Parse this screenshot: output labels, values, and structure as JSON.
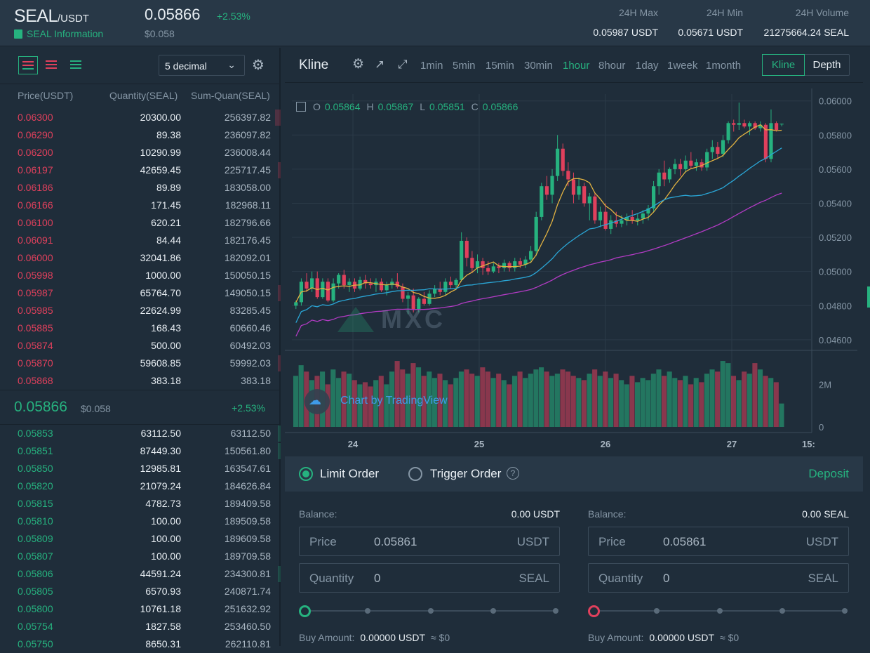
{
  "header": {
    "pair_base": "SEAL",
    "pair_quote": "/USDT",
    "info_link": "SEAL Information",
    "last_price": "0.05866",
    "change": "+2.53%",
    "usd_price": "$0.058",
    "stats": [
      {
        "label": "24H Max",
        "value": "0.05987 USDT"
      },
      {
        "label": "24H Min",
        "value": "0.05671 USDT"
      },
      {
        "label": "24H Volume",
        "value": "21275664.24 SEAL"
      }
    ]
  },
  "orderbook": {
    "decimal": "5 decimal",
    "headers": {
      "price": "Price(USDT)",
      "quantity": "Quantity(SEAL)",
      "sum": "Sum-Quan(SEAL)"
    },
    "asks": [
      {
        "price": "0.06300",
        "qty": "20300.00",
        "sum": "256397.82",
        "depth": 0.02
      },
      {
        "price": "0.06290",
        "qty": "89.38",
        "sum": "236097.82",
        "depth": 0.0
      },
      {
        "price": "0.06200",
        "qty": "10290.99",
        "sum": "236008.44",
        "depth": 0.0
      },
      {
        "price": "0.06197",
        "qty": "42659.45",
        "sum": "225717.45",
        "depth": 0.01
      },
      {
        "price": "0.06186",
        "qty": "89.89",
        "sum": "183058.00",
        "depth": 0.0
      },
      {
        "price": "0.06166",
        "qty": "171.45",
        "sum": "182968.11",
        "depth": 0.0
      },
      {
        "price": "0.06100",
        "qty": "620.21",
        "sum": "182796.66",
        "depth": 0.0
      },
      {
        "price": "0.06091",
        "qty": "84.44",
        "sum": "182176.45",
        "depth": 0.0
      },
      {
        "price": "0.06000",
        "qty": "32041.86",
        "sum": "182092.01",
        "depth": 0.0
      },
      {
        "price": "0.05998",
        "qty": "1000.00",
        "sum": "150050.15",
        "depth": 0.0
      },
      {
        "price": "0.05987",
        "qty": "65764.70",
        "sum": "149050.15",
        "depth": 0.01
      },
      {
        "price": "0.05985",
        "qty": "22624.99",
        "sum": "83285.45",
        "depth": 0.0
      },
      {
        "price": "0.05885",
        "qty": "168.43",
        "sum": "60660.46",
        "depth": 0.0
      },
      {
        "price": "0.05874",
        "qty": "500.00",
        "sum": "60492.03",
        "depth": 0.0
      },
      {
        "price": "0.05870",
        "qty": "59608.85",
        "sum": "59992.03",
        "depth": 0.01
      },
      {
        "price": "0.05868",
        "qty": "383.18",
        "sum": "383.18",
        "depth": 0.0
      }
    ],
    "mid_price": "0.05866",
    "mid_usd": "$0.058",
    "mid_change": "+2.53%",
    "bids": [
      {
        "price": "0.05853",
        "qty": "63112.50",
        "sum": "63112.50",
        "depth": 0.01
      },
      {
        "price": "0.05851",
        "qty": "87449.30",
        "sum": "150561.80",
        "depth": 0.01
      },
      {
        "price": "0.05850",
        "qty": "12985.81",
        "sum": "163547.61",
        "depth": 0.0
      },
      {
        "price": "0.05820",
        "qty": "21079.24",
        "sum": "184626.84",
        "depth": 0.0
      },
      {
        "price": "0.05815",
        "qty": "4782.73",
        "sum": "189409.58",
        "depth": 0.0
      },
      {
        "price": "0.05810",
        "qty": "100.00",
        "sum": "189509.58",
        "depth": 0.0
      },
      {
        "price": "0.05809",
        "qty": "100.00",
        "sum": "189609.58",
        "depth": 0.0
      },
      {
        "price": "0.05807",
        "qty": "100.00",
        "sum": "189709.58",
        "depth": 0.0
      },
      {
        "price": "0.05806",
        "qty": "44591.24",
        "sum": "234300.81",
        "depth": 0.01
      },
      {
        "price": "0.05805",
        "qty": "6570.93",
        "sum": "240871.74",
        "depth": 0.0
      },
      {
        "price": "0.05800",
        "qty": "10761.18",
        "sum": "251632.92",
        "depth": 0.0
      },
      {
        "price": "0.05754",
        "qty": "1827.58",
        "sum": "253460.50",
        "depth": 0.0
      },
      {
        "price": "0.05750",
        "qty": "8650.31",
        "sum": "262110.81",
        "depth": 0.0
      }
    ]
  },
  "chart": {
    "title": "Kline",
    "intervals": [
      "1min",
      "5min",
      "15min",
      "30min",
      "1hour",
      "8hour",
      "1day",
      "1week",
      "1month"
    ],
    "active_interval": "1hour",
    "views": [
      "Kline",
      "Depth"
    ],
    "active_view": "Kline",
    "ohlc": {
      "o": "0.05864",
      "h": "0.05867",
      "l": "0.05851",
      "c": "0.05866"
    },
    "watermark": "MXC",
    "tradingview": "Chart by TradingView",
    "x_ticks": [
      "24",
      "25",
      "26",
      "27",
      "15:"
    ],
    "volume_ticks": [
      "2M",
      "0"
    ]
  },
  "chart_data": {
    "type": "candlestick",
    "y_ticks": [
      "0.06000",
      "0.05800",
      "0.05600",
      "0.05400",
      "0.05200",
      "0.05000",
      "0.04800",
      "0.04600"
    ],
    "ylim": [
      0.0455,
      0.0604
    ],
    "volume_ylim": [
      0,
      3300000
    ],
    "colors": {
      "up": "#26b27f",
      "down": "#e0405c",
      "ma7": "#e3b341",
      "ma25": "#2aa6d6",
      "ma99": "#b23bc4"
    },
    "candles": [
      [
        0.048,
        0.0483,
        0.0478,
        0.0482,
        2400000
      ],
      [
        0.0482,
        0.0496,
        0.048,
        0.0494,
        2900000
      ],
      [
        0.0494,
        0.0499,
        0.0488,
        0.049,
        2600000
      ],
      [
        0.049,
        0.05,
        0.0488,
        0.0496,
        2200000
      ],
      [
        0.0496,
        0.05,
        0.0484,
        0.0485,
        2400000
      ],
      [
        0.0485,
        0.0496,
        0.0484,
        0.0494,
        2600000
      ],
      [
        0.0494,
        0.0496,
        0.0482,
        0.0483,
        2000000
      ],
      [
        0.0483,
        0.0496,
        0.0482,
        0.0493,
        2700000
      ],
      [
        0.0493,
        0.0499,
        0.049,
        0.0498,
        2300000
      ],
      [
        0.0498,
        0.0501,
        0.049,
        0.0492,
        2600000
      ],
      [
        0.0492,
        0.0496,
        0.0488,
        0.0494,
        2500000
      ],
      [
        0.0494,
        0.0496,
        0.0488,
        0.049,
        2200000
      ],
      [
        0.049,
        0.0497,
        0.0489,
        0.0495,
        2000000
      ],
      [
        0.0495,
        0.0498,
        0.049,
        0.0493,
        2100000
      ],
      [
        0.0493,
        0.0496,
        0.049,
        0.0492,
        1900000
      ],
      [
        0.0492,
        0.0496,
        0.0488,
        0.0494,
        2200000
      ],
      [
        0.0494,
        0.0496,
        0.0488,
        0.0489,
        2400000
      ],
      [
        0.0489,
        0.0494,
        0.0486,
        0.0492,
        2000000
      ],
      [
        0.0492,
        0.0496,
        0.049,
        0.0494,
        2600000
      ],
      [
        0.0494,
        0.0499,
        0.049,
        0.0491,
        3100000
      ],
      [
        0.0491,
        0.0493,
        0.0482,
        0.0484,
        2700000
      ],
      [
        0.0484,
        0.0488,
        0.0475,
        0.0486,
        2500000
      ],
      [
        0.0486,
        0.049,
        0.0476,
        0.0478,
        3000000
      ],
      [
        0.0478,
        0.0485,
        0.0476,
        0.0484,
        2800000
      ],
      [
        0.0484,
        0.0488,
        0.048,
        0.0481,
        2400000
      ],
      [
        0.0481,
        0.0489,
        0.048,
        0.0487,
        2600000
      ],
      [
        0.0487,
        0.0492,
        0.0485,
        0.049,
        2300000
      ],
      [
        0.049,
        0.0494,
        0.0486,
        0.0488,
        2500000
      ],
      [
        0.0488,
        0.0496,
        0.0486,
        0.0494,
        2200000
      ],
      [
        0.0494,
        0.0497,
        0.049,
        0.0492,
        2000000
      ],
      [
        0.0492,
        0.0496,
        0.049,
        0.0495,
        2300000
      ],
      [
        0.0495,
        0.0523,
        0.0494,
        0.0518,
        2600000
      ],
      [
        0.0518,
        0.052,
        0.0503,
        0.0508,
        2700000
      ],
      [
        0.0508,
        0.0512,
        0.0499,
        0.0502,
        2500000
      ],
      [
        0.0502,
        0.051,
        0.0499,
        0.0506,
        2400000
      ],
      [
        0.0506,
        0.0508,
        0.0498,
        0.0502,
        2800000
      ],
      [
        0.0502,
        0.0506,
        0.0498,
        0.05,
        2600000
      ],
      [
        0.05,
        0.0505,
        0.0499,
        0.0503,
        2300000
      ],
      [
        0.0503,
        0.0505,
        0.0499,
        0.0502,
        2500000
      ],
      [
        0.0502,
        0.0507,
        0.05,
        0.0505,
        2200000
      ],
      [
        0.0505,
        0.0506,
        0.05,
        0.0502,
        2000000
      ],
      [
        0.0502,
        0.0508,
        0.05,
        0.0506,
        2400000
      ],
      [
        0.0506,
        0.0508,
        0.0502,
        0.0504,
        2600000
      ],
      [
        0.0504,
        0.0509,
        0.0502,
        0.0507,
        2300000
      ],
      [
        0.0507,
        0.0515,
        0.0505,
        0.0512,
        2500000
      ],
      [
        0.0512,
        0.0535,
        0.0509,
        0.0532,
        2700000
      ],
      [
        0.0532,
        0.0552,
        0.053,
        0.055,
        2800000
      ],
      [
        0.055,
        0.0556,
        0.0542,
        0.0545,
        2600000
      ],
      [
        0.0545,
        0.056,
        0.054,
        0.0556,
        2400000
      ],
      [
        0.0556,
        0.058,
        0.0553,
        0.0572,
        2500000
      ],
      [
        0.0572,
        0.0575,
        0.0556,
        0.0559,
        2700000
      ],
      [
        0.0559,
        0.0564,
        0.055,
        0.0554,
        2600000
      ],
      [
        0.0554,
        0.0558,
        0.054,
        0.0545,
        2400000
      ],
      [
        0.0545,
        0.0555,
        0.0542,
        0.055,
        2300000
      ],
      [
        0.055,
        0.0552,
        0.0538,
        0.054,
        2200000
      ],
      [
        0.054,
        0.0546,
        0.053,
        0.0544,
        2500000
      ],
      [
        0.0544,
        0.0546,
        0.0528,
        0.053,
        2700000
      ],
      [
        0.053,
        0.0538,
        0.0526,
        0.0535,
        2400000
      ],
      [
        0.0535,
        0.054,
        0.0524,
        0.0525,
        2600000
      ],
      [
        0.0525,
        0.0533,
        0.0522,
        0.053,
        2300000
      ],
      [
        0.053,
        0.0535,
        0.0526,
        0.0528,
        2500000
      ],
      [
        0.0528,
        0.0533,
        0.0526,
        0.053,
        2200000
      ],
      [
        0.053,
        0.0534,
        0.0527,
        0.0532,
        2000000
      ],
      [
        0.0532,
        0.0536,
        0.0528,
        0.053,
        2400000
      ],
      [
        0.053,
        0.0534,
        0.0527,
        0.0531,
        2100000
      ],
      [
        0.0531,
        0.0536,
        0.0528,
        0.0534,
        2300000
      ],
      [
        0.0534,
        0.0539,
        0.053,
        0.0537,
        2200000
      ],
      [
        0.0537,
        0.0553,
        0.0535,
        0.055,
        2500000
      ],
      [
        0.055,
        0.056,
        0.0545,
        0.0558,
        2700000
      ],
      [
        0.0558,
        0.0565,
        0.055,
        0.0554,
        2400000
      ],
      [
        0.0554,
        0.0561,
        0.0552,
        0.056,
        2600000
      ],
      [
        0.056,
        0.0566,
        0.0557,
        0.0563,
        2300000
      ],
      [
        0.0563,
        0.0566,
        0.0556,
        0.056,
        2200000
      ],
      [
        0.056,
        0.0568,
        0.0558,
        0.0565,
        2400000
      ],
      [
        0.0565,
        0.057,
        0.056,
        0.0562,
        2000000
      ],
      [
        0.0562,
        0.0566,
        0.0559,
        0.0564,
        2300000
      ],
      [
        0.0564,
        0.0566,
        0.0559,
        0.0561,
        2100000
      ],
      [
        0.0561,
        0.0572,
        0.0559,
        0.057,
        2500000
      ],
      [
        0.057,
        0.0577,
        0.0566,
        0.0573,
        2700000
      ],
      [
        0.0573,
        0.0576,
        0.0566,
        0.0569,
        2600000
      ],
      [
        0.0569,
        0.058,
        0.0567,
        0.0577,
        3100000
      ],
      [
        0.0577,
        0.0588,
        0.0575,
        0.0587,
        3000000
      ],
      [
        0.0587,
        0.0589,
        0.0582,
        0.0586,
        2400000
      ],
      [
        0.0586,
        0.0599,
        0.0583,
        0.0587,
        2200000
      ],
      [
        0.0587,
        0.0589,
        0.0584,
        0.0585,
        2600000
      ],
      [
        0.0585,
        0.0588,
        0.058,
        0.0587,
        2500000
      ],
      [
        0.0587,
        0.0588,
        0.0583,
        0.0584,
        3000000
      ],
      [
        0.0584,
        0.0588,
        0.0582,
        0.0586,
        2700000
      ],
      [
        0.0586,
        0.0587,
        0.0564,
        0.0566,
        2400000
      ],
      [
        0.0566,
        0.0595,
        0.0564,
        0.0587,
        2300000
      ],
      [
        0.0587,
        0.0588,
        0.0582,
        0.0583,
        2100000
      ],
      [
        0.05864,
        0.05867,
        0.05851,
        0.05866,
        1100000
      ]
    ]
  },
  "order": {
    "tabs": [
      "Limit Order",
      "Trigger Order"
    ],
    "active_tab": "Limit Order",
    "deposit": "Deposit",
    "buy": {
      "balance_label": "Balance:",
      "balance": "0.00 USDT",
      "price_label": "Price",
      "price": "0.05861",
      "price_unit": "USDT",
      "qty_label": "Quantity",
      "qty": "0",
      "qty_unit": "SEAL",
      "amount_label": "Buy Amount:",
      "amount": "0.00000 USDT",
      "amount_usd": "≈ $0",
      "slider": 0
    },
    "sell": {
      "balance_label": "Balance:",
      "balance": "0.00 SEAL",
      "price_label": "Price",
      "price": "0.05861",
      "price_unit": "USDT",
      "qty_label": "Quantity",
      "qty": "0",
      "qty_unit": "SEAL",
      "amount_label": "Buy Amount:",
      "amount": "0.00000 USDT",
      "amount_usd": "≈ $0",
      "slider": 0
    }
  }
}
